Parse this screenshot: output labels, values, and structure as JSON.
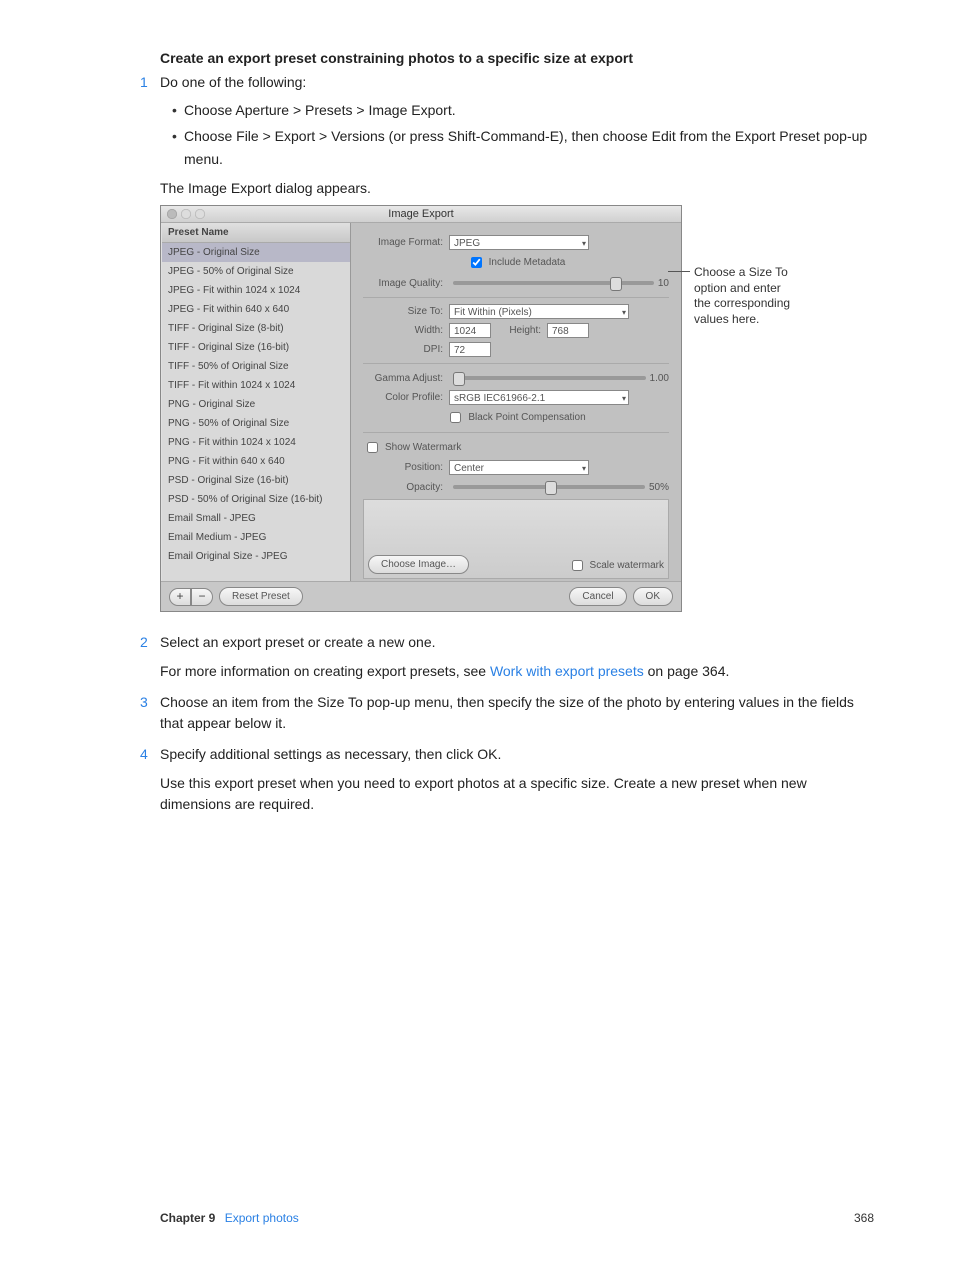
{
  "heading": "Create an export preset constraining photos to a specific size at export",
  "steps": {
    "s1": "Do one of the following:",
    "s1_bullets": [
      "Choose Aperture > Presets > Image Export.",
      "Choose File > Export > Versions (or press Shift-Command-E), then choose Edit from the Export Preset pop-up menu."
    ],
    "s1_after": "The Image Export dialog appears.",
    "s2": "Select an export preset or create a new one.",
    "s2_after_prefix": "For more information on creating export presets, see ",
    "s2_link": "Work with export presets",
    "s2_after_suffix": " on page 364.",
    "s3": "Choose an item from the Size To pop-up menu, then specify the size of the photo by entering values in the fields that appear below it.",
    "s4": "Specify additional settings as necessary, then click OK.",
    "final": "Use this export preset when you need to export photos at a specific size. Create a new preset when new dimensions are required."
  },
  "screenshot": {
    "window_title": "Image Export",
    "sidebar_header": "Preset Name",
    "presets": [
      "JPEG - Original Size",
      "JPEG - 50% of Original Size",
      "JPEG - Fit within 1024 x 1024",
      "JPEG - Fit within 640 x 640",
      "TIFF - Original Size (8-bit)",
      "TIFF - Original Size (16-bit)",
      "TIFF - 50% of Original Size",
      "TIFF - Fit within 1024 x 1024",
      "PNG - Original Size",
      "PNG - 50% of Original Size",
      "PNG - Fit within 1024 x 1024",
      "PNG - Fit within 640 x 640",
      "PSD - Original Size (16-bit)",
      "PSD - 50% of Original Size (16-bit)",
      "Email Small - JPEG",
      "Email Medium - JPEG",
      "Email Original Size - JPEG"
    ],
    "labels": {
      "image_format": "Image Format:",
      "include_metadata": "Include Metadata",
      "image_quality": "Image Quality:",
      "size_to": "Size To:",
      "width": "Width:",
      "height": "Height:",
      "dpi": "DPI:",
      "gamma_adjust": "Gamma Adjust:",
      "color_profile": "Color Profile:",
      "black_point": "Black Point Compensation",
      "show_watermark": "Show Watermark",
      "position": "Position:",
      "opacity": "Opacity:",
      "choose_image": "Choose Image…",
      "scale_watermark": "Scale watermark",
      "reset_preset": "Reset Preset",
      "cancel": "Cancel",
      "ok": "OK",
      "plus": "+",
      "minus": "−"
    },
    "values": {
      "image_format": "JPEG",
      "image_quality": "10",
      "size_to": "Fit Within (Pixels)",
      "width": "1024",
      "height": "768",
      "dpi": "72",
      "gamma": "1.00",
      "color_profile": "sRGB IEC61966-2.1",
      "position": "Center",
      "opacity": "50%"
    }
  },
  "callout": {
    "l1": "Choose a Size To",
    "l2": "option and enter",
    "l3": "the corresponding",
    "l4": "values here."
  },
  "footer": {
    "chapter_num": "Chapter 9",
    "chapter_title": "Export photos",
    "page_number": "368"
  }
}
